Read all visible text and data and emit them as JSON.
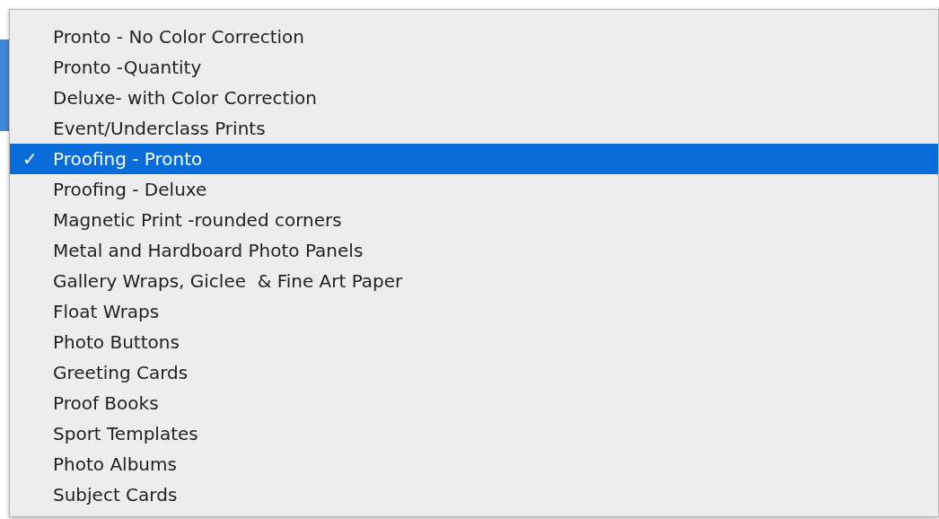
{
  "menu": {
    "items": [
      {
        "label": "Pronto - No Color Correction",
        "selected": false
      },
      {
        "label": "Pronto -Quantity",
        "selected": false
      },
      {
        "label": "Deluxe- with Color Correction",
        "selected": false
      },
      {
        "label": "Event/Underclass Prints",
        "selected": false
      },
      {
        "label": "Proofing - Pronto",
        "selected": true,
        "check": "✓"
      },
      {
        "label": "Proofing - Deluxe",
        "selected": false
      },
      {
        "label": "Magnetic Print -rounded corners",
        "selected": false
      },
      {
        "label": "Metal and Hardboard Photo Panels",
        "selected": false
      },
      {
        "label": "Gallery Wraps, Giclee  & Fine Art Paper",
        "selected": false
      },
      {
        "label": "Float Wraps",
        "selected": false
      },
      {
        "label": "Photo Buttons",
        "selected": false
      },
      {
        "label": "Greeting Cards",
        "selected": false
      },
      {
        "label": "Proof Books",
        "selected": false
      },
      {
        "label": "Sport Templates",
        "selected": false
      },
      {
        "label": "Photo Albums",
        "selected": false
      },
      {
        "label": "Subject Cards",
        "selected": false
      }
    ]
  }
}
